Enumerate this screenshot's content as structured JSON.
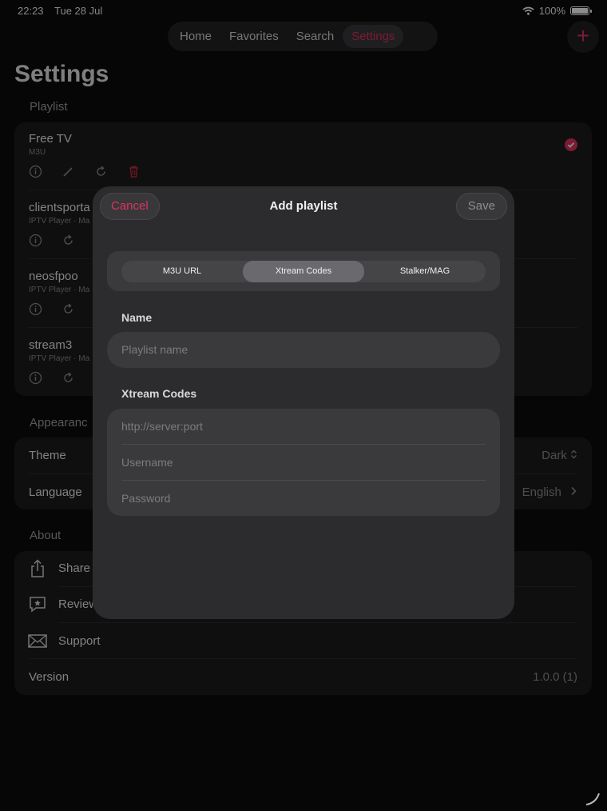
{
  "status": {
    "time": "22:23",
    "date": "Tue 28 Jul",
    "battery": "100%"
  },
  "tabs": [
    {
      "label": "Home",
      "active": false
    },
    {
      "label": "Favorites",
      "active": false
    },
    {
      "label": "Search",
      "active": false
    },
    {
      "label": "Settings",
      "active": true
    }
  ],
  "add_label": "+",
  "page": {
    "title": "Settings",
    "playlist_section": "Playlist",
    "playlists": [
      {
        "title": "Free TV",
        "subtitle": "M3U",
        "selected": true
      },
      {
        "title": "clientsporta",
        "subtitle": "IPTV Player · Ma"
      },
      {
        "title": "neosfpoo",
        "subtitle": "IPTV Player · Ma"
      },
      {
        "title": "stream3",
        "subtitle": "IPTV Player · Ma"
      }
    ],
    "appearance_section": "Appearanc",
    "theme_label": "Theme",
    "theme_value": "Dark",
    "language_label": "Language",
    "language_value": "English",
    "about_section": "About",
    "share_label": "Share",
    "review_label": "Review",
    "support_label": "Support",
    "version_label": "Version",
    "version_value": "1.0.0 (1)"
  },
  "modal": {
    "cancel": "Cancel",
    "title": "Add playlist",
    "save": "Save",
    "segments": [
      {
        "label": "M3U URL",
        "active": false
      },
      {
        "label": "Xtream Codes",
        "active": true
      },
      {
        "label": "Stalker/MAG",
        "active": false
      }
    ],
    "name_label": "Name",
    "name_placeholder": "Playlist name",
    "xtream_label": "Xtream Codes",
    "server_placeholder": "http://server:port",
    "username_placeholder": "Username",
    "password_placeholder": "Password"
  },
  "colors": {
    "accent": "#e0325f",
    "background": "#0b0b0c",
    "card": "#1c1c1e",
    "modal": "#2c2c2e"
  },
  "icons": [
    "wifi-icon",
    "battery-icon",
    "plus-icon",
    "checkmark-circle-icon",
    "info-icon",
    "pencil-icon",
    "refresh-icon",
    "trash-icon",
    "share-icon",
    "review-icon",
    "envelope-icon",
    "chevron-right-icon",
    "chevron-updown-icon"
  ]
}
